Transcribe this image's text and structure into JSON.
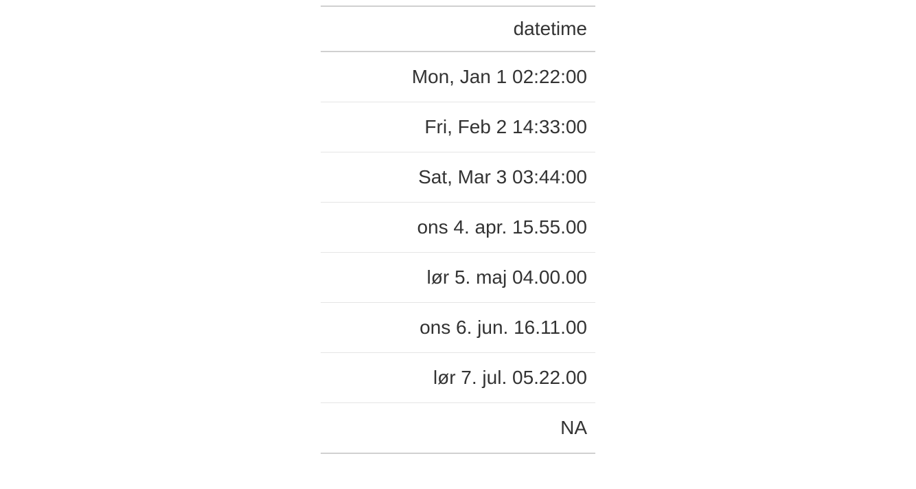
{
  "chart_data": {
    "type": "table",
    "title": "",
    "columns": [
      "datetime"
    ],
    "rows": [
      [
        "Mon, Jan 1 02:22:00"
      ],
      [
        "Fri, Feb 2 14:33:00"
      ],
      [
        "Sat, Mar 3 03:44:00"
      ],
      [
        "ons 4. apr. 15.55.00"
      ],
      [
        "lør 5. maj 04.00.00"
      ],
      [
        "ons 6. jun. 16.11.00"
      ],
      [
        "lør 7. jul. 05.22.00"
      ],
      [
        "NA"
      ]
    ]
  },
  "table": {
    "header": "datetime",
    "rows": [
      "Mon, Jan 1 02:22:00",
      "Fri, Feb 2 14:33:00",
      "Sat, Mar 3 03:44:00",
      "ons 4. apr. 15.55.00",
      "lør 5. maj 04.00.00",
      "ons 6. jun. 16.11.00",
      "lør 7. jul. 05.22.00",
      "NA"
    ]
  }
}
